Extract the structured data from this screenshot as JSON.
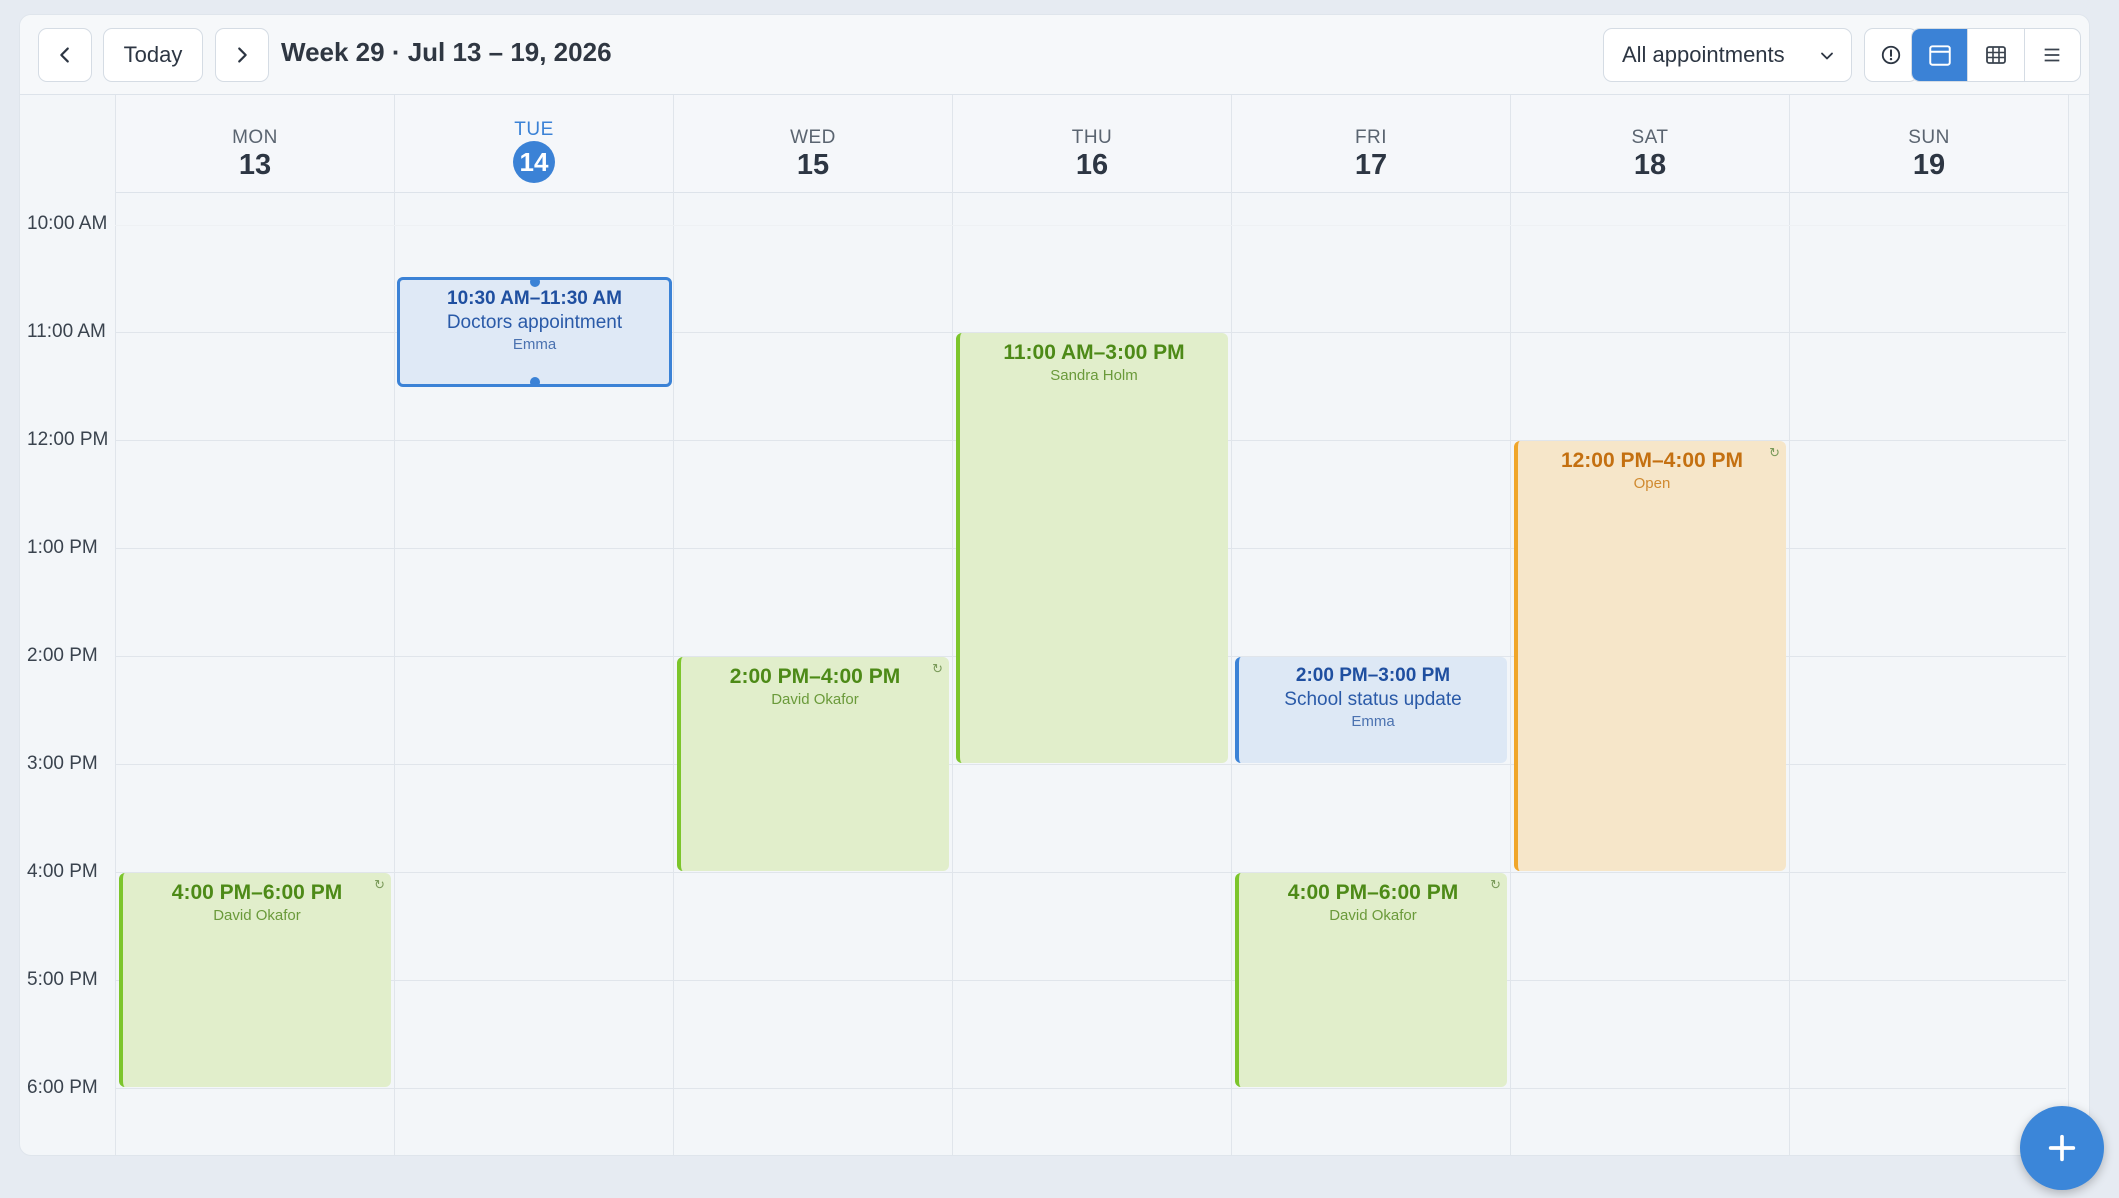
{
  "toolbar": {
    "prev_icon": "chevron-left-icon",
    "today_label": "Today",
    "next_icon": "chevron-right-icon",
    "week_title": "Week 29 · Jul 13 – 19, 2026",
    "filter_value": "All appointments",
    "info_icon": "info-icon",
    "views": [
      "calendar-view-icon",
      "table-view-icon",
      "list-view-icon"
    ],
    "active_view": "calendar-view-icon"
  },
  "days": [
    {
      "dow": "MON",
      "num": "13"
    },
    {
      "dow": "TUE",
      "num": "14",
      "today": true
    },
    {
      "dow": "WED",
      "num": "15"
    },
    {
      "dow": "THU",
      "num": "16"
    },
    {
      "dow": "FRI",
      "num": "17"
    },
    {
      "dow": "SAT",
      "num": "18"
    },
    {
      "dow": "SUN",
      "num": "19"
    }
  ],
  "time_labels": [
    "10:00 AM",
    "11:00 AM",
    "12:00 PM",
    "1:00 PM",
    "2:00 PM",
    "3:00 PM",
    "4:00 PM",
    "5:00 PM",
    "6:00 PM"
  ],
  "events": [
    {
      "time": "10:30 AM–11:30 AM",
      "title": "Doctors appointment",
      "person": "Emma",
      "day": "TUE"
    },
    {
      "time": "11:00 AM–3:00 PM",
      "title": "",
      "person": "Sandra Holm",
      "day": "THU"
    },
    {
      "time": "12:00 PM–4:00 PM",
      "title": "",
      "person": "Open",
      "day": "SAT"
    },
    {
      "time": "2:00 PM–4:00 PM",
      "title": "",
      "person": "David Okafor",
      "day": "WED"
    },
    {
      "time": "2:00 PM–3:00 PM",
      "title": "School status update",
      "person": "Emma",
      "day": "FRI"
    },
    {
      "time": "4:00 PM–6:00 PM",
      "title": "",
      "person": "David Okafor",
      "day": "MON"
    },
    {
      "time": "4:00 PM–6:00 PM",
      "title": "",
      "person": "David Okafor",
      "day": "FRI"
    }
  ],
  "colors": {
    "accent": "#3b82d6",
    "green_event": "#e1eecb",
    "blue_event": "#dde8f5",
    "orange_event": "#f6e6c9"
  },
  "fab_icon": "plus-icon"
}
